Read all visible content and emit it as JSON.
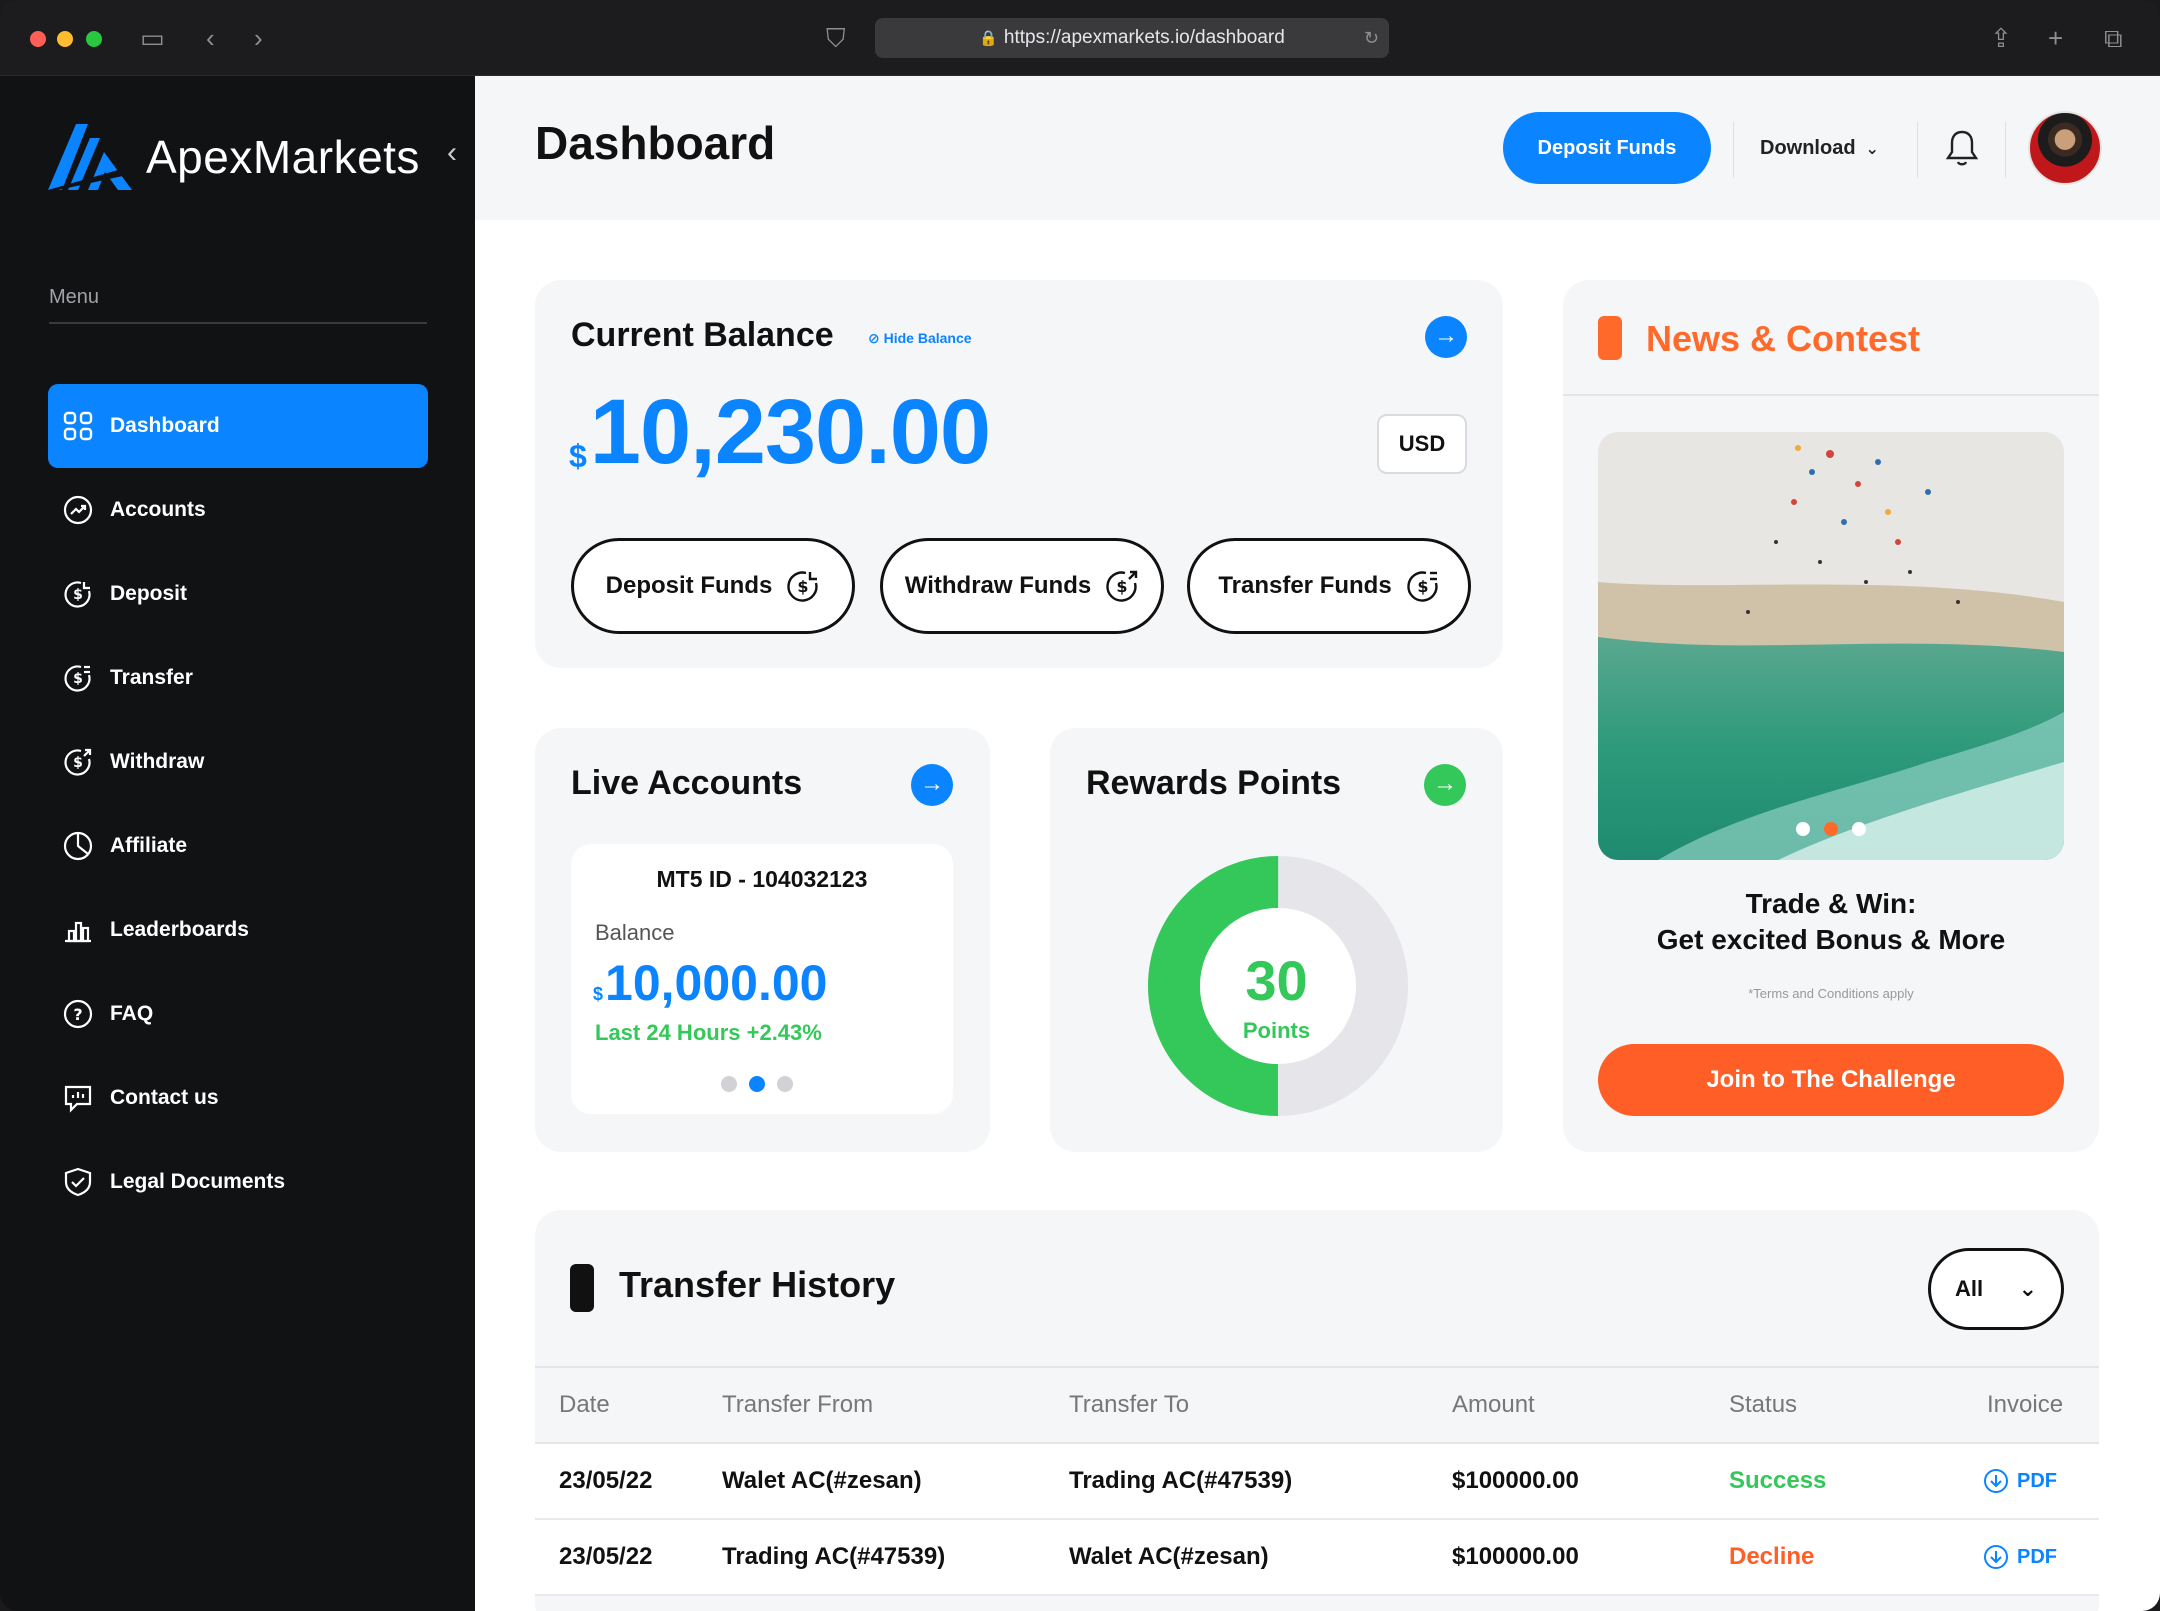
{
  "browser": {
    "url": "https://apexmarkets.io/dashboard"
  },
  "brand": {
    "name": "ApexMarkets",
    "accent": "#0a84ff",
    "orange": "#ff5e26",
    "green": "#34c759"
  },
  "sidebar": {
    "menu_label": "Menu",
    "items": [
      {
        "label": "Dashboard",
        "icon": "grid-icon",
        "active": true
      },
      {
        "label": "Accounts",
        "icon": "trend-icon"
      },
      {
        "label": "Deposit",
        "icon": "dollar-in-icon"
      },
      {
        "label": "Transfer",
        "icon": "dollar-transfer-icon"
      },
      {
        "label": "Withdraw",
        "icon": "dollar-out-icon"
      },
      {
        "label": "Affiliate",
        "icon": "pie-icon"
      },
      {
        "label": "Leaderboards",
        "icon": "bar-chart-icon"
      },
      {
        "label": "FAQ",
        "icon": "question-icon"
      },
      {
        "label": "Contact us",
        "icon": "chat-icon"
      },
      {
        "label": "Legal Documents",
        "icon": "shield-check-icon"
      }
    ]
  },
  "header": {
    "title": "Dashboard",
    "deposit_label": "Deposit Funds",
    "download_label": "Download"
  },
  "balance": {
    "title": "Current Balance",
    "hide_label": "Hide Balance",
    "currency_symbol": "$",
    "amount": "10,230.00",
    "currency": "USD",
    "actions": [
      "Deposit Funds",
      "Withdraw Funds",
      "Transfer Funds"
    ]
  },
  "live_accounts": {
    "title": "Live Accounts",
    "account_id": "MT5 ID - 104032123",
    "balance_label": "Balance",
    "currency_symbol": "$",
    "amount": "10,000.00",
    "change": "Last 24 Hours +2.43%",
    "slide_count": 3,
    "active_slide": 2
  },
  "rewards": {
    "title": "Rewards Points",
    "value": "30",
    "unit": "Points",
    "progress_fraction": 0.5
  },
  "news": {
    "title": "News & Contest",
    "headline_1": "Trade & Win:",
    "headline_2": "Get excited Bonus & More",
    "terms": "*Terms and Conditions apply",
    "cta": "Join to The Challenge",
    "slide_count": 3,
    "active_slide": 2
  },
  "history": {
    "title": "Transfer History",
    "filter": "All",
    "columns": [
      "Date",
      "Transfer From",
      "Transfer To",
      "Amount",
      "Status",
      "Invoice"
    ],
    "rows": [
      {
        "date": "23/05/22",
        "from": "Walet AC(#zesan)",
        "to": "Trading AC(#47539)",
        "amount": "$100000.00",
        "status": "Success",
        "invoice": "PDF"
      },
      {
        "date": "23/05/22",
        "from": "Trading AC(#47539)",
        "to": "Walet AC(#zesan)",
        "amount": "$100000.00",
        "status": "Decline",
        "invoice": "PDF"
      }
    ]
  }
}
